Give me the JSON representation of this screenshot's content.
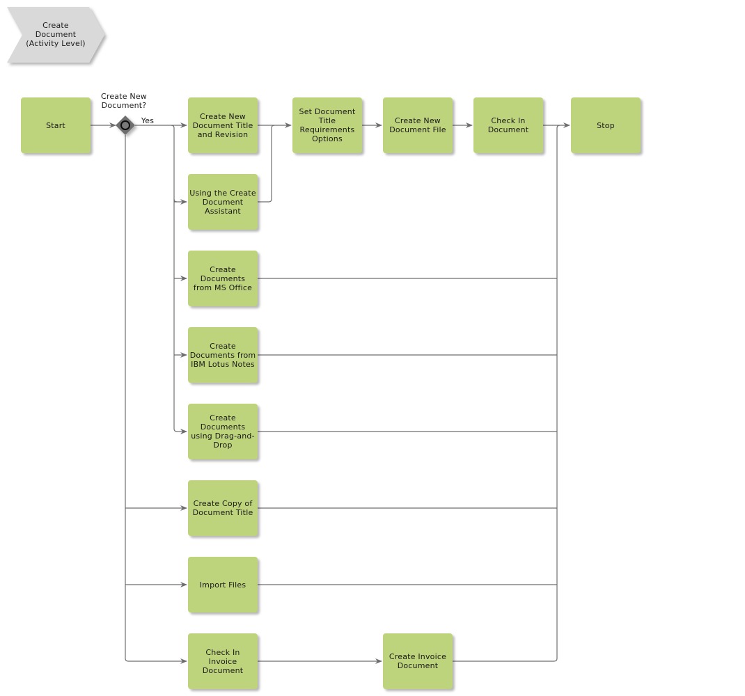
{
  "header": {
    "title": "Create\nDocument\n(Activity Level)"
  },
  "colors": {
    "activity_fill": "#bdd37c",
    "header_fill": "#d9d9d9",
    "gateway_fill": "#6e6e6e",
    "connector": "#6e6e6e"
  },
  "gateway": {
    "question": "Create New\nDocument?",
    "yes_label": "Yes"
  },
  "nodes": {
    "start": "Start",
    "create_title_revision": "Create New\nDocument Title\nand Revision",
    "create_assistant": "Using the Create\nDocument\nAssistant",
    "set_title_req": "Set Document\nTitle\nRequirements\nOptions",
    "create_file": "Create New\nDocument File",
    "check_in": "Check In\nDocument",
    "stop": "Stop",
    "ms_office": "Create\nDocuments\nfrom MS Office",
    "lotus_notes": "Create\nDocuments from\nIBM Lotus Notes",
    "drag_drop": "Create\nDocuments\nusing Drag-and-\nDrop",
    "copy_title": "Create Copy of\nDocument Title",
    "import_files": "Import Files",
    "check_in_invoice": "Check In\nInvoice\nDocument",
    "create_invoice": "Create Invoice\nDocument"
  }
}
